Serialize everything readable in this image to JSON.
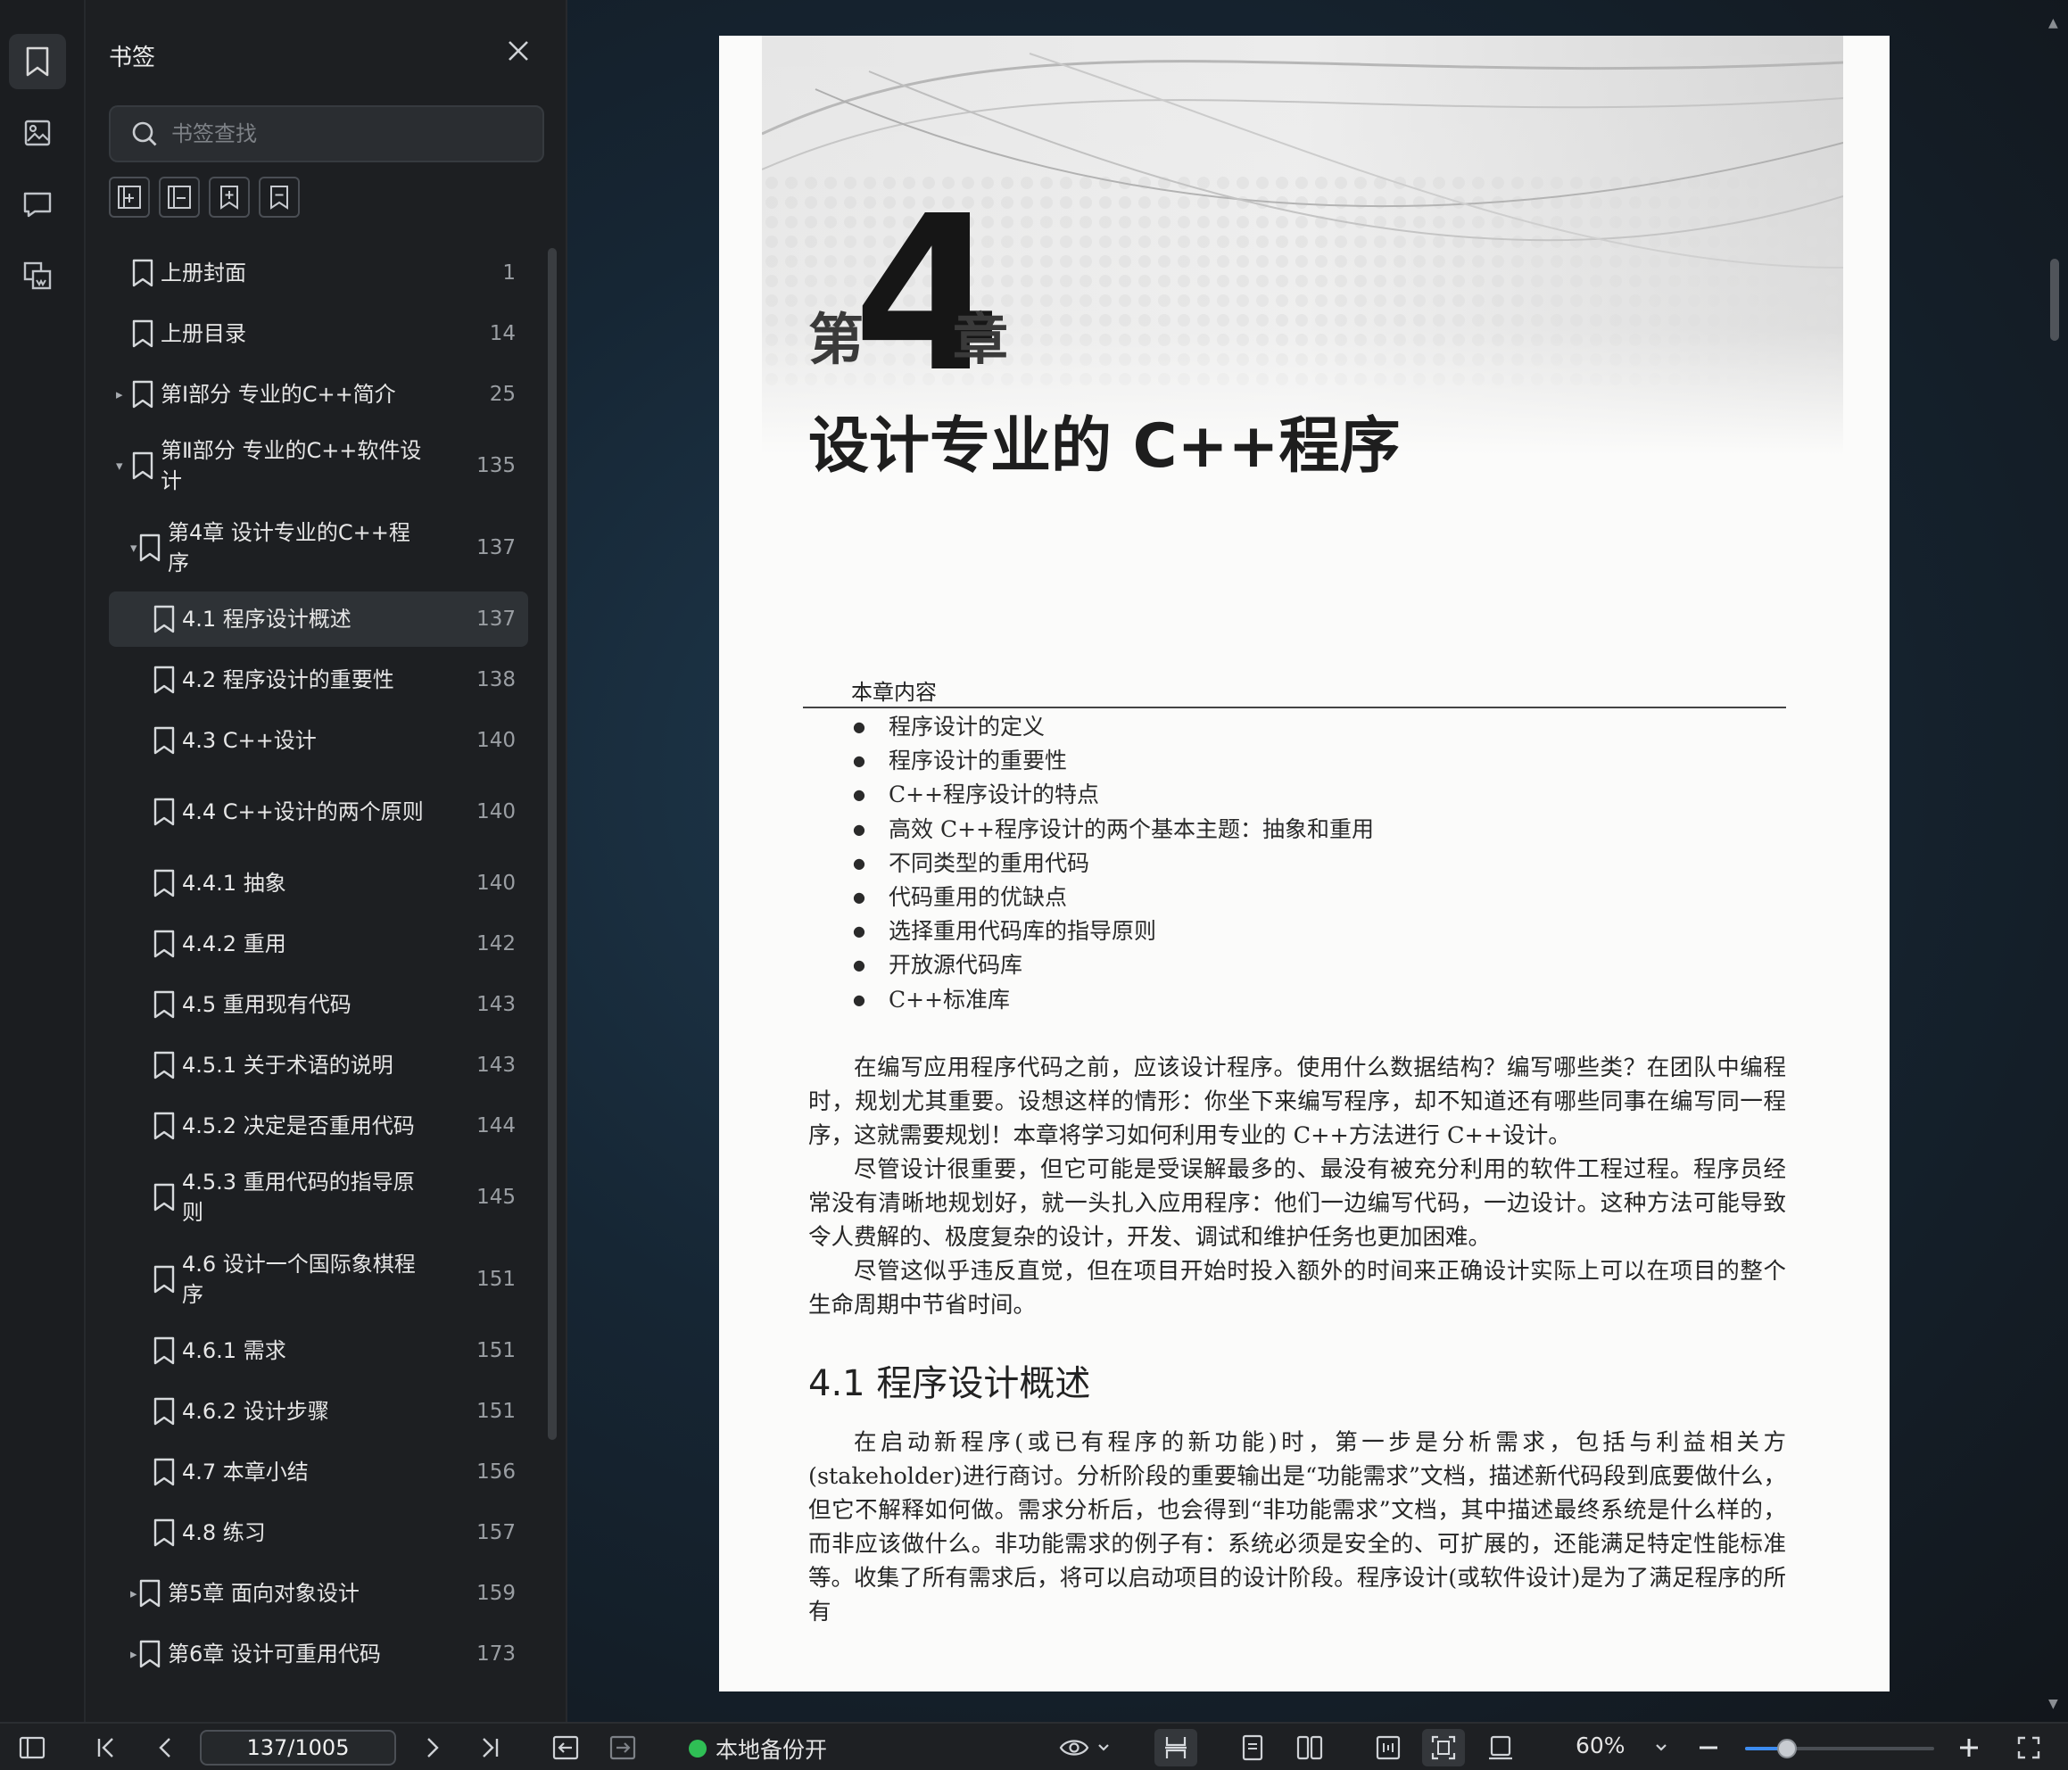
{
  "panel": {
    "title": "书签",
    "search_placeholder": "书签查找"
  },
  "bookmarks": [
    {
      "label": "上册封面",
      "page": "1",
      "level": 0,
      "arrow": "",
      "lines": 1
    },
    {
      "label": "上册目录",
      "page": "14",
      "level": 0,
      "arrow": "",
      "lines": 1
    },
    {
      "label": "第Ⅰ部分  专业的C++简介",
      "page": "25",
      "level": 0,
      "arrow": "▸",
      "lines": 1
    },
    {
      "label": "第Ⅱ部分  专业的C++软件设计",
      "page": "135",
      "level": 0,
      "arrow": "▾",
      "lines": 2
    },
    {
      "label": "第4章  设计专业的C++程序",
      "page": "137",
      "level": 1,
      "arrow": "▾",
      "lines": 2
    },
    {
      "label": "4.1  程序设计概述",
      "page": "137",
      "level": 2,
      "arrow": "",
      "lines": 1,
      "active": true
    },
    {
      "label": "4.2  程序设计的重要性",
      "page": "138",
      "level": 2,
      "arrow": "",
      "lines": 1
    },
    {
      "label": "4.3  C++设计",
      "page": "140",
      "level": 2,
      "arrow": "",
      "lines": 1
    },
    {
      "label": "4.4  C++设计的两个原则",
      "page": "140",
      "level": 2,
      "arrow": "",
      "lines": 2
    },
    {
      "label": "4.4.1  抽象",
      "page": "140",
      "level": 2,
      "arrow": "",
      "lines": 1
    },
    {
      "label": "4.4.2  重用",
      "page": "142",
      "level": 2,
      "arrow": "",
      "lines": 1
    },
    {
      "label": "4.5  重用现有代码",
      "page": "143",
      "level": 2,
      "arrow": "",
      "lines": 1
    },
    {
      "label": "4.5.1  关于术语的说明",
      "page": "143",
      "level": 2,
      "arrow": "",
      "lines": 1
    },
    {
      "label": "4.5.2  决定是否重用代码",
      "page": "144",
      "level": 2,
      "arrow": "",
      "lines": 1
    },
    {
      "label": "4.5.3  重用代码的指导原则",
      "page": "145",
      "level": 2,
      "arrow": "",
      "lines": 2
    },
    {
      "label": "4.6  设计一个国际象棋程序",
      "page": "151",
      "level": 2,
      "arrow": "",
      "lines": 2
    },
    {
      "label": "4.6.1  需求",
      "page": "151",
      "level": 2,
      "arrow": "",
      "lines": 1
    },
    {
      "label": "4.6.2  设计步骤",
      "page": "151",
      "level": 2,
      "arrow": "",
      "lines": 1
    },
    {
      "label": "4.7  本章小结",
      "page": "156",
      "level": 2,
      "arrow": "",
      "lines": 1
    },
    {
      "label": "4.8  练习",
      "page": "157",
      "level": 2,
      "arrow": "",
      "lines": 1
    },
    {
      "label": "第5章  面向对象设计",
      "page": "159",
      "level": 1,
      "arrow": "▸",
      "lines": 1
    },
    {
      "label": "第6章  设计可重用代码",
      "page": "173",
      "level": 1,
      "arrow": "▸",
      "lines": 1
    }
  ],
  "doc": {
    "chapter_prefix": "第",
    "chapter_number": "4",
    "chapter_suffix": "章",
    "chapter_title": "设计专业的 C++程序",
    "contents_heading": "本章内容",
    "contents": [
      "程序设计的定义",
      "程序设计的重要性",
      "C++程序设计的特点",
      "高效 C++程序设计的两个基本主题：抽象和重用",
      "不同类型的重用代码",
      "代码重用的优缺点",
      "选择重用代码库的指导原则",
      "开放源代码库",
      "C++标准库"
    ],
    "paragraphs": [
      "在编写应用程序代码之前，应该设计程序。使用什么数据结构？编写哪些类？在团队中编程时，规划尤其重要。设想这样的情形：你坐下来编写程序，却不知道还有哪些同事在编写同一程序，这就需要规划！本章将学习如何利用专业的 C++方法进行 C++设计。",
      "尽管设计很重要，但它可能是受误解最多的、最没有被充分利用的软件工程过程。程序员经常没有清晰地规划好，就一头扎入应用程序：他们一边编写代码，一边设计。这种方法可能导致令人费解的、极度复杂的设计，开发、调试和维护任务也更加困难。",
      "尽管这似乎违反直觉，但在项目开始时投入额外的时间来正确设计实际上可以在项目的整个生命周期中节省时间。"
    ],
    "section_title": "4.1    程序设计概述",
    "section_paragraphs": [
      "在启动新程序(或已有程序的新功能)时，第一步是分析需求，包括与利益相关方(stakeholder)进行商讨。分析阶段的重要输出是“功能需求”文档，描述新代码段到底要做什么，但它不解释如何做。需求分析后，也会得到“非功能需求”文档，其中描述最终系统是什么样的，而非应该做什么。非功能需求的例子有：系统必须是安全的、可扩展的，还能满足特定性能标准等。",
      "收集了所有需求后，将可以启动项目的设计阶段。程序设计(或软件设计)是为了满足程序的所有"
    ]
  },
  "toolbar": {
    "page_indicator": "137/1005",
    "backup_label": "本地备份开",
    "zoom_level": "60%",
    "zoom_fraction": 0.22
  }
}
